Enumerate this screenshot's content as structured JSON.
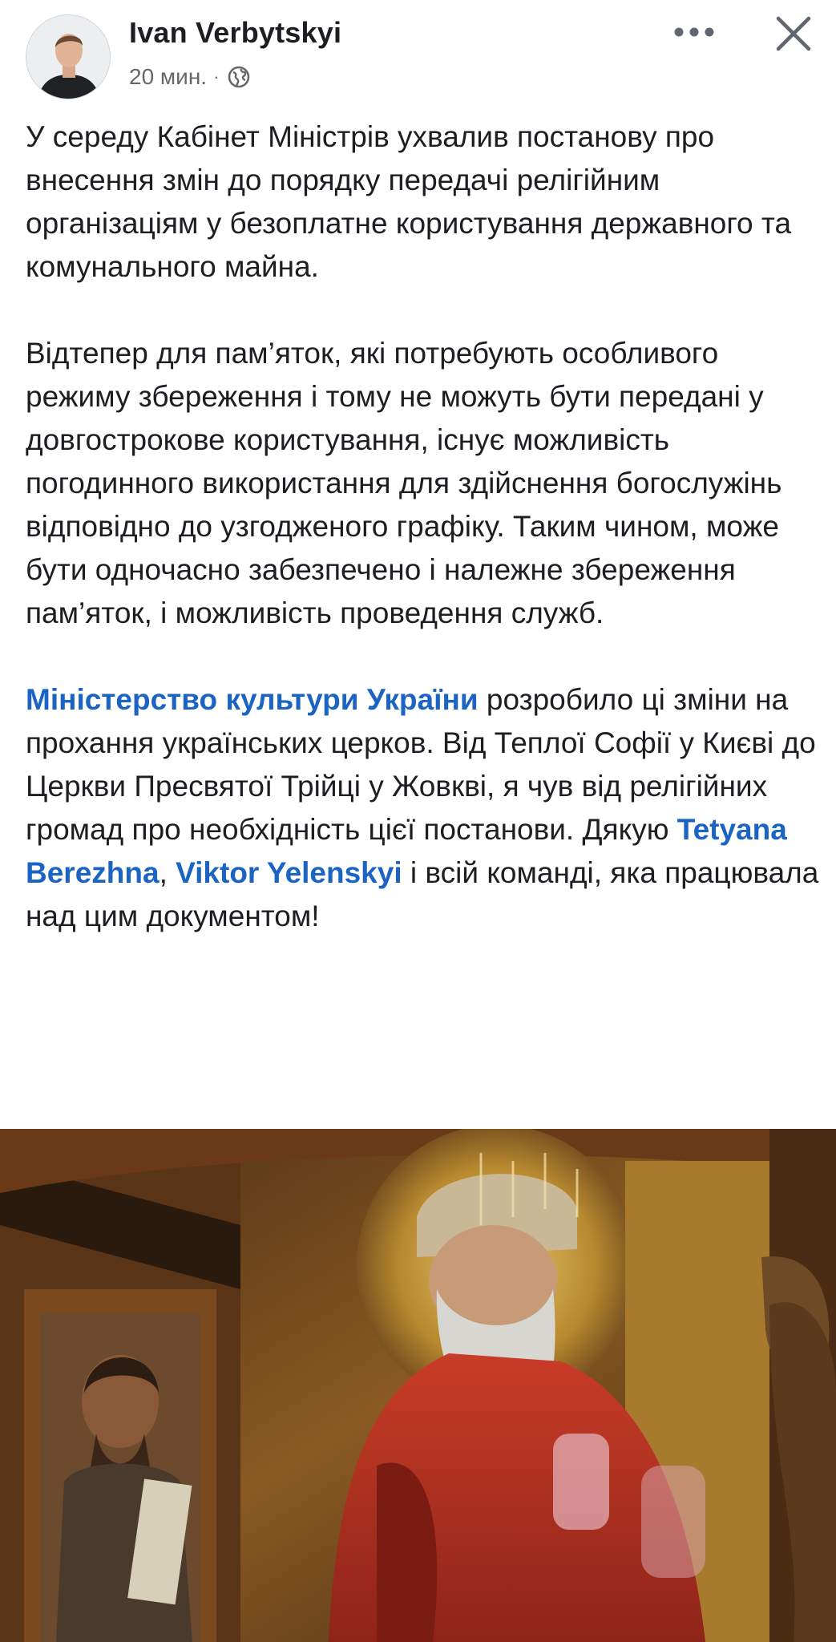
{
  "header": {
    "author_name": "Ivan Verbytskyi",
    "timestamp": "20 мин.",
    "separator": "·",
    "privacy_icon": "globe-icon",
    "more_icon": "more-horizontal-icon",
    "close_icon": "close-icon"
  },
  "post": {
    "paragraph1": "У середу Кабінет Міністрів ухвалив постанову про внесення змін до порядку передачі релігійним організаціям у безоплатне користування державного та комунального майна.",
    "paragraph2": "Відтепер для пам’яток, які потребують особливого режиму збереження і тому не можуть бути передані у довгострокове користування, існує можливість погодинного використання для здійснення богослужінь відповідно до узгодженого графіку. Таким чином, може бути одночасно забезпечено і належне збереження пам’яток, і можливість проведення служб.",
    "paragraph3": {
      "mention1": "Міністерство культури України",
      "text1": " розробило ці зміни на прохання українських церков. Від Теплої Софії у Києві до Церкви Пресвятої Трійці у Жовкві, я чув від релігійних громад про необхідність цієї постанови. Дякую ",
      "mention2": "Tetyana Berezhna",
      "text2": ", ",
      "mention3": "Viktor Yelenskyi",
      "text3": " і всій команді, яка працювала над цим документом!"
    }
  },
  "photo": {
    "subject": "church-icon-interior-photo"
  },
  "colors": {
    "mention": "#1b64c4",
    "text": "#1c1e21",
    "meta": "#65676b"
  }
}
